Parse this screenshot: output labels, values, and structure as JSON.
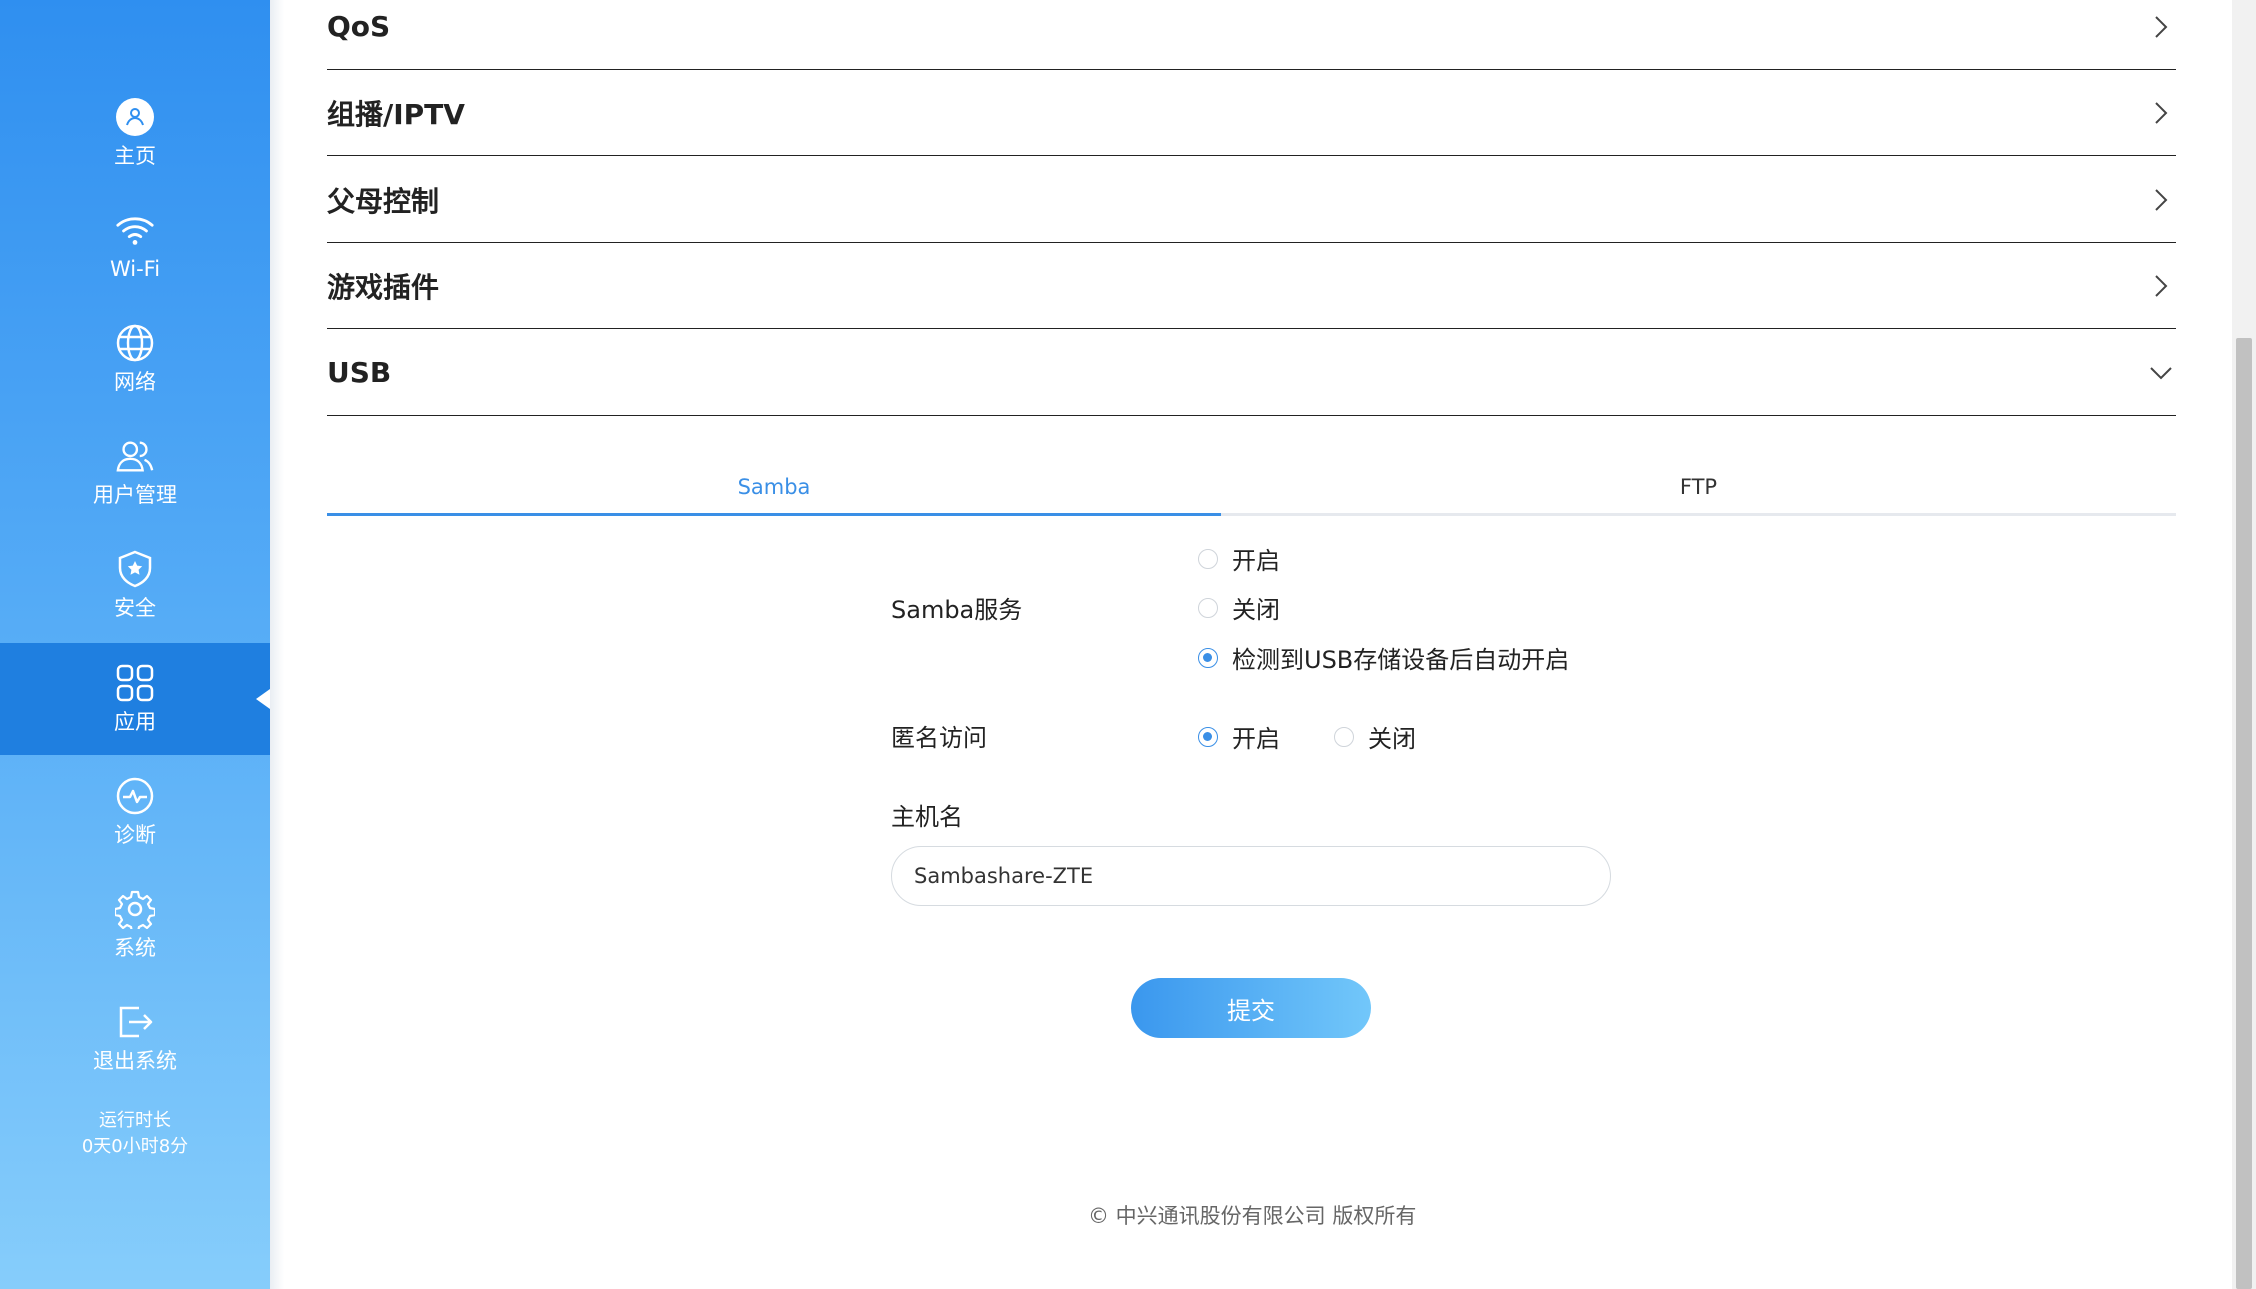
{
  "sidebar": {
    "items": [
      {
        "label": "主页",
        "icon": "home-user-icon"
      },
      {
        "label": "Wi-Fi",
        "icon": "wifi-icon"
      },
      {
        "label": "网络",
        "icon": "globe-icon"
      },
      {
        "label": "用户管理",
        "icon": "users-icon"
      },
      {
        "label": "安全",
        "icon": "shield-icon"
      },
      {
        "label": "应用",
        "icon": "apps-grid-icon"
      },
      {
        "label": "诊断",
        "icon": "diagnose-icon"
      },
      {
        "label": "系统",
        "icon": "gear-icon"
      },
      {
        "label": "退出系统",
        "icon": "logout-icon"
      }
    ],
    "active_item": "应用",
    "uptime_label": "运行时长",
    "uptime_value": "0天0小时8分"
  },
  "sections": [
    {
      "title": "QoS",
      "state": "collapsed"
    },
    {
      "title": "组播/IPTV",
      "state": "collapsed"
    },
    {
      "title": "父母控制",
      "state": "collapsed"
    },
    {
      "title": "游戏插件",
      "state": "collapsed"
    },
    {
      "title": "USB",
      "state": "expanded"
    }
  ],
  "tabs": [
    {
      "label": "Samba",
      "active": true
    },
    {
      "label": "FTP",
      "active": false
    }
  ],
  "form": {
    "samba_service_label": "Samba服务",
    "samba_options": [
      "开启",
      "关闭",
      "检测到USB存储设备后自动开启"
    ],
    "samba_selected": "检测到USB存储设备后自动开启",
    "anonymous_label": "匿名访问",
    "anonymous_options": [
      "开启",
      "关闭"
    ],
    "anonymous_selected": "开启",
    "hostname_label": "主机名",
    "hostname_value": "Sambashare-ZTE",
    "submit_label": "提交"
  },
  "footer": "© 中兴通讯股份有限公司 版权所有",
  "colors": {
    "accent": "#3a8fe6",
    "sidebar_top": "#2f8ff0",
    "sidebar_bottom": "#86cdfb",
    "active_nav": "#1f7fe0"
  }
}
